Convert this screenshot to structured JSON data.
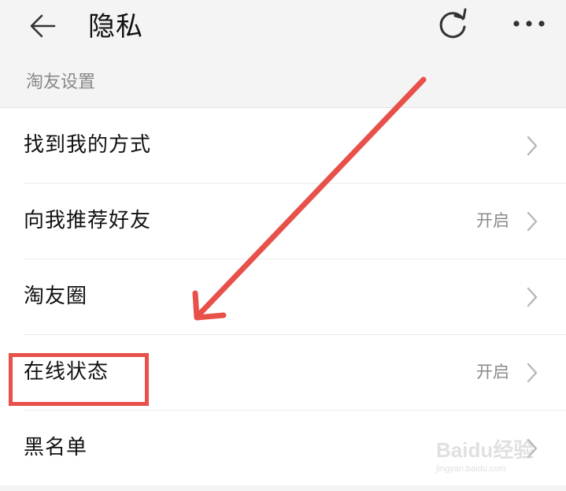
{
  "header": {
    "title": "隐私",
    "back_icon": "arrow-left-icon",
    "refresh_icon": "refresh-icon",
    "more_icon": "more-horizontal-icon"
  },
  "section": {
    "title": "淘友设置"
  },
  "rows": [
    {
      "label": "找到我的方式",
      "value": ""
    },
    {
      "label": "向我推荐好友",
      "value": "开启"
    },
    {
      "label": "淘友圈",
      "value": ""
    },
    {
      "label": "在线状态",
      "value": "开启"
    },
    {
      "label": "黑名单",
      "value": ""
    }
  ],
  "annotation": {
    "color": "#e8504a",
    "highlighted_row": "在线状态"
  },
  "watermark": {
    "logo": "Baidu经验",
    "url": "jingyan.baidu.com"
  }
}
